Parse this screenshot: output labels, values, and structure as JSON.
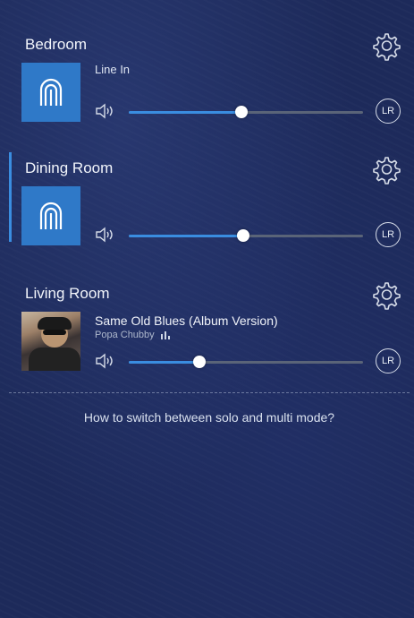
{
  "rooms": [
    {
      "name": "Bedroom",
      "source": "Line In",
      "volume": 0.48,
      "lr_label": "LR",
      "artwork": "speaker-logo-icon",
      "active": false
    },
    {
      "name": "Dining Room",
      "source": "",
      "volume": 0.49,
      "lr_label": "LR",
      "artwork": "speaker-logo-icon",
      "active": true
    },
    {
      "name": "Living Room",
      "track": "Same Old Blues (Album Version)",
      "artist": "Popa Chubby",
      "volume": 0.3,
      "lr_label": "LR",
      "artwork": "album-art",
      "active": false
    }
  ],
  "help": {
    "text": "How to switch between solo and multi mode?"
  },
  "colors": {
    "accent": "#3a8de0",
    "tile": "#2f79c8",
    "background": "#1d2a5a"
  }
}
